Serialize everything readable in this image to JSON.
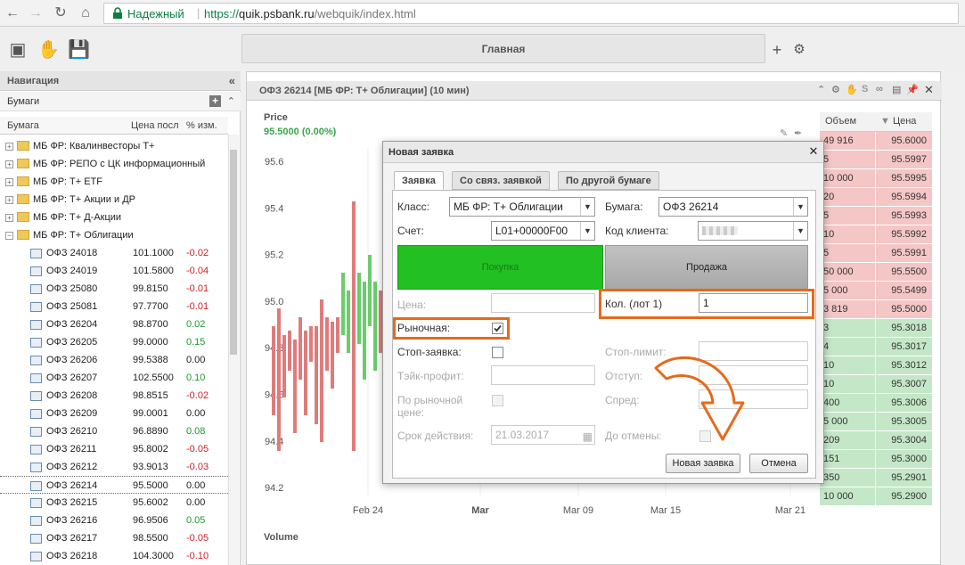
{
  "browser": {
    "secure_label": "Надежный",
    "url_scheme": "https://",
    "url_host": "quik.psbank.ru",
    "url_path": "/webquik/index.html"
  },
  "app": {
    "main_tab": "Главная"
  },
  "nav": {
    "title": "Навигация",
    "section": "Бумаги",
    "columns": [
      "Бумага",
      "Цена посл",
      "% изм."
    ],
    "groups": [
      {
        "label": "МБ ФР: Квалинвесторы Т+",
        "expanded": false
      },
      {
        "label": "МБ ФР: РЕПО с ЦК информационный",
        "expanded": false
      },
      {
        "label": "МБ ФР: Т+ ETF",
        "expanded": false
      },
      {
        "label": "МБ ФР: Т+ Акции и ДР",
        "expanded": false
      },
      {
        "label": "МБ ФР: Т+ Д-Акции",
        "expanded": false
      },
      {
        "label": "МБ ФР: Т+ Облигации",
        "expanded": true
      }
    ],
    "bonds": [
      {
        "name": "ОФЗ 24018",
        "price": "101.1000",
        "change": "-0.02"
      },
      {
        "name": "ОФЗ 24019",
        "price": "101.5800",
        "change": "-0.04"
      },
      {
        "name": "ОФЗ 25080",
        "price": "99.8150",
        "change": "-0.01"
      },
      {
        "name": "ОФЗ 25081",
        "price": "97.7700",
        "change": "-0.01"
      },
      {
        "name": "ОФЗ 26204",
        "price": "98.8700",
        "change": "0.02"
      },
      {
        "name": "ОФЗ 26205",
        "price": "99.0000",
        "change": "0.15"
      },
      {
        "name": "ОФЗ 26206",
        "price": "99.5388",
        "change": "0.00"
      },
      {
        "name": "ОФЗ 26207",
        "price": "102.5500",
        "change": "0.10"
      },
      {
        "name": "ОФЗ 26208",
        "price": "98.8515",
        "change": "-0.02"
      },
      {
        "name": "ОФЗ 26209",
        "price": "99.0001",
        "change": "0.00"
      },
      {
        "name": "ОФЗ 26210",
        "price": "96.8890",
        "change": "0.08"
      },
      {
        "name": "ОФЗ 26211",
        "price": "95.8002",
        "change": "-0.05"
      },
      {
        "name": "ОФЗ 26212",
        "price": "93.9013",
        "change": "-0.03"
      },
      {
        "name": "ОФЗ 26214",
        "price": "95.5000",
        "change": "0.00"
      },
      {
        "name": "ОФЗ 26215",
        "price": "95.6002",
        "change": "0.00"
      },
      {
        "name": "ОФЗ 26216",
        "price": "96.9506",
        "change": "0.05"
      },
      {
        "name": "ОФЗ 26217",
        "price": "98.5500",
        "change": "-0.05"
      },
      {
        "name": "ОФЗ 26218",
        "price": "104.3000",
        "change": "-0.10"
      }
    ]
  },
  "chart": {
    "title": "ОФЗ 26214 [МБ ФР: Т+ Облигации] (10 мин)",
    "price_label": "Price",
    "price_value": "95.5000 (0.00%)",
    "y_ticks": [
      "95.6",
      "95.4",
      "95.2",
      "95.0",
      "94.8",
      "94.6",
      "94.4",
      "94.2"
    ],
    "x_ticks": [
      "Feb 24",
      "Mar",
      "Mar 09",
      "Mar 15",
      "Mar 21"
    ],
    "volume_label": "Volume"
  },
  "orderbook": {
    "col_volume": "Объем",
    "col_price": "Цена",
    "colors": {
      "sell": "#f4c6c6",
      "buy": "#c4e7c8"
    },
    "rows": [
      {
        "vol": "49 916",
        "price": "95.6000",
        "side": "sell"
      },
      {
        "vol": "5",
        "price": "95.5997",
        "side": "sell"
      },
      {
        "vol": "10 000",
        "price": "95.5995",
        "side": "sell"
      },
      {
        "vol": "20",
        "price": "95.5994",
        "side": "sell"
      },
      {
        "vol": "5",
        "price": "95.5993",
        "side": "sell"
      },
      {
        "vol": "10",
        "price": "95.5992",
        "side": "sell"
      },
      {
        "vol": "5",
        "price": "95.5991",
        "side": "sell"
      },
      {
        "vol": "50 000",
        "price": "95.5500",
        "side": "sell"
      },
      {
        "vol": "5 000",
        "price": "95.5499",
        "side": "sell"
      },
      {
        "vol": "3 819",
        "price": "95.5000",
        "side": "sell"
      },
      {
        "vol": "3",
        "price": "95.3018",
        "side": "buy"
      },
      {
        "vol": "4",
        "price": "95.3017",
        "side": "buy"
      },
      {
        "vol": "10",
        "price": "95.3012",
        "side": "buy"
      },
      {
        "vol": "10",
        "price": "95.3007",
        "side": "buy"
      },
      {
        "vol": "400",
        "price": "95.3006",
        "side": "buy"
      },
      {
        "vol": "5 000",
        "price": "95.3005",
        "side": "buy"
      },
      {
        "vol": "209",
        "price": "95.3004",
        "side": "buy"
      },
      {
        "vol": "151",
        "price": "95.3000",
        "side": "buy"
      },
      {
        "vol": "350",
        "price": "95.2901",
        "side": "buy"
      },
      {
        "vol": "10 000",
        "price": "95.2900",
        "side": "buy"
      }
    ]
  },
  "order": {
    "title": "Новая заявка",
    "tabs": [
      "Заявка",
      "Со связ. заявкой",
      "По другой бумаге"
    ],
    "class_label": "Класс:",
    "class_value": "МБ ФР: Т+ Облигации",
    "security_label": "Бумага:",
    "security_value": "ОФЗ 26214",
    "account_label": "Счет:",
    "account_value": "L01+00000F00",
    "client_label": "Код клиента:",
    "buy_label": "Покупка",
    "sell_label": "Продажа",
    "price_label": "Цена:",
    "qty_label": "Кол. (лот 1)",
    "qty_value": "1",
    "market_label": "Рыночная:",
    "stop_label": "Стоп-заявка:",
    "stoplimit_label": "Стоп-лимит:",
    "takeprofit_label": "Тэйк-профит:",
    "offset_label": "Отступ:",
    "bymarket_label": "По рыночной цене:",
    "spread_label": "Спред:",
    "expiry_label": "Срок действия:",
    "expiry_value": "21.03.2017",
    "until_cancel_label": "До отмены:",
    "submit_label": "Новая заявка",
    "cancel_label": "Отмена",
    "colors": {
      "buy": "#22c022",
      "sell": "#b4b4b4",
      "highlight": "#e66a1a"
    }
  }
}
